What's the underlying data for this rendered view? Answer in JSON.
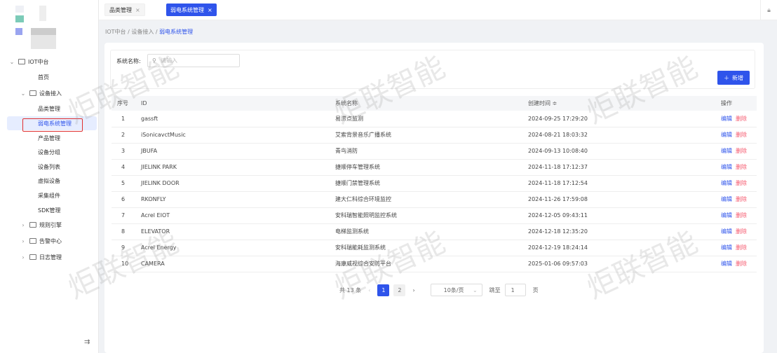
{
  "tabs": [
    {
      "label": "品类管理",
      "close": "×"
    },
    {
      "label": "弱电系统管理",
      "close": "×"
    }
  ],
  "breadcrumb": [
    "IOT中台",
    "设备接入",
    "弱电系统管理"
  ],
  "breadcrumb_sep": "/",
  "sidebar": {
    "root": "IOT中台",
    "home": "首页",
    "group": "设备接入",
    "items": [
      "品类管理",
      "弱电系统管理",
      "产品管理",
      "设备分组",
      "设备列表",
      "虚拟设备",
      "采集组件",
      "SDK管理"
    ],
    "collapsed": [
      "规则引擎",
      "告警中心",
      "日志管理"
    ],
    "active": "弱电系统管理"
  },
  "search": {
    "label": "系统名称:",
    "placeholder": "请输入"
  },
  "add_label": "新增",
  "table": {
    "headers": [
      "序号",
      "ID",
      "系统名称",
      "创建时间 ≑",
      "操作"
    ],
    "rows": [
      [
        "1",
        "gassft",
        "易涝点监测",
        "2024-09-25 17:29:20"
      ],
      [
        "2",
        "iSonicavctMusic",
        "艾索背景音乐广播系统",
        "2024-08-21 18:03:32"
      ],
      [
        "3",
        "JBUFA",
        "青鸟消防",
        "2024-09-13 10:08:40"
      ],
      [
        "4",
        "JIELINK PARK",
        "捷顺停车管理系统",
        "2024-11-18 17:12:37"
      ],
      [
        "5",
        "JIELINK DOOR",
        "捷顺门禁管理系统",
        "2024-11-18 17:12:54"
      ],
      [
        "6",
        "RKONFLY",
        "建大仁科综合环境监控",
        "2024-11-26 17:59:08"
      ],
      [
        "7",
        "Acrel EIOT",
        "安科瑞智能照明监控系统",
        "2024-12-05 09:43:11"
      ],
      [
        "8",
        "ELEVATOR",
        "电梯监测系统",
        "2024-12-18 12:35:20"
      ],
      [
        "9",
        "Acrel Energy",
        "安科瑞能耗监测系统",
        "2024-12-19 18:24:14"
      ],
      [
        "10",
        "CAMERA",
        "海康威视综合安防平台",
        "2025-01-06 09:57:03"
      ]
    ],
    "edit": "编辑",
    "delete": "删除"
  },
  "pagination": {
    "total": "共 13 条",
    "pages": [
      "1",
      "2"
    ],
    "current": "1",
    "page_size": "10条/页",
    "jump_label": "跳至",
    "jump_value": "1",
    "page_suffix": "页"
  },
  "watermark": "炬联智能",
  "colors": {
    "primary": "#2f54eb",
    "danger": "#f5576c",
    "highlight": "#e03030"
  }
}
